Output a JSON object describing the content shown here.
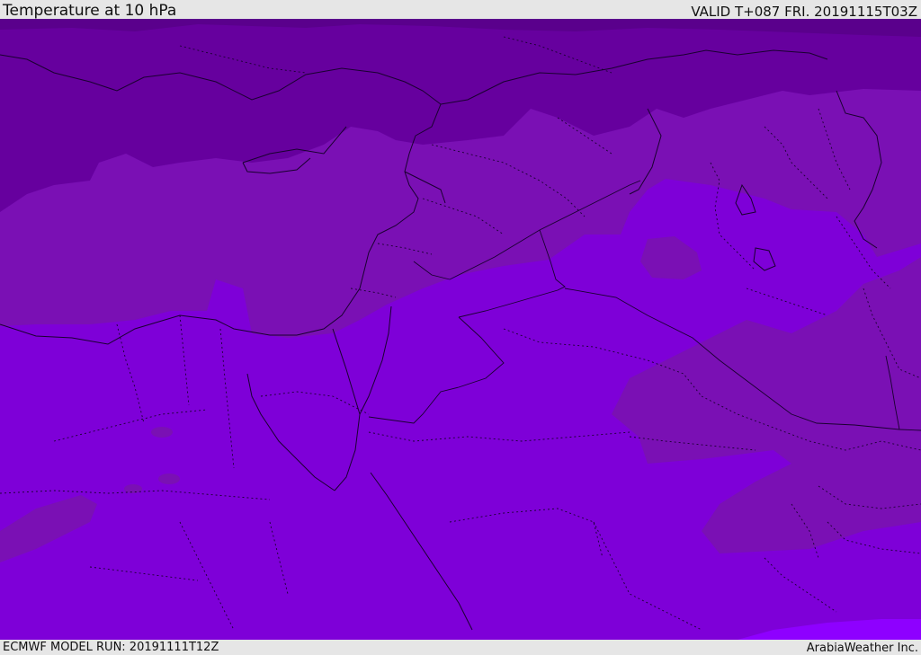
{
  "header": {
    "title": "Temperature at 10 hPa",
    "valid_time": "VALID T+087 FRI. 20191115T03Z"
  },
  "footer": {
    "model_run": "ECMWF MODEL RUN: 20191111T12Z",
    "credit": "ArabiaWeather Inc."
  },
  "colors": {
    "band_darkest": "#5a008c",
    "band_dark": "#66009e",
    "band_mid": "#7a10b4",
    "band_main": "#7e00d8",
    "band_light": "#8e00ff",
    "border_line": "#1a0030"
  },
  "map": {
    "region": "Eastern Mediterranean / Middle East"
  }
}
